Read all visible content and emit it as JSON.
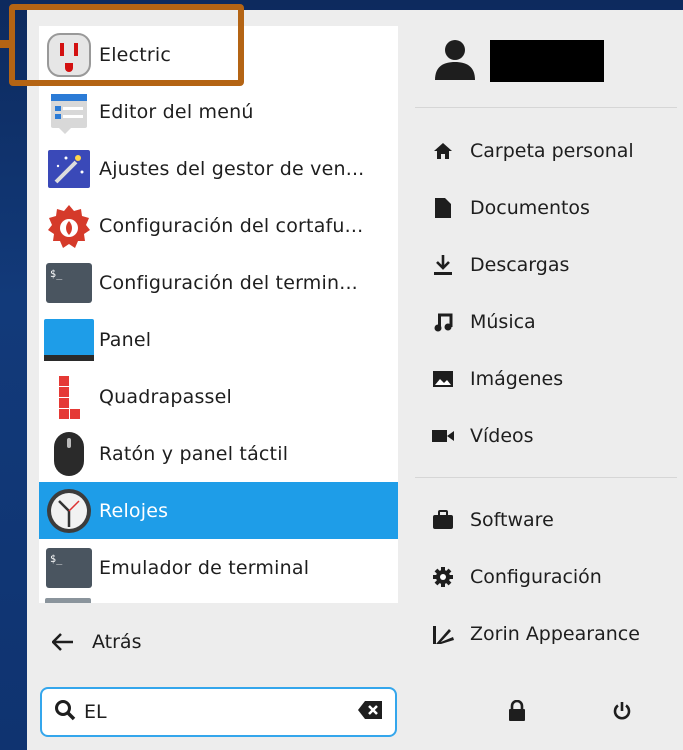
{
  "apps": [
    {
      "label": "Electric",
      "icon": "electric-outlet-icon"
    },
    {
      "label": "Editor del menú",
      "icon": "menu-editor-icon"
    },
    {
      "label": "Ajustes del gestor de ven...",
      "icon": "window-manager-tweaks-icon"
    },
    {
      "label": "Configuración del cortafu...",
      "icon": "firewall-icon"
    },
    {
      "label": "Configuración del termin...",
      "icon": "terminal-icon"
    },
    {
      "label": "Panel",
      "icon": "panel-icon"
    },
    {
      "label": "Quadrapassel",
      "icon": "quadrapassel-icon"
    },
    {
      "label": "Ratón y panel táctil",
      "icon": "mouse-icon"
    },
    {
      "label": "Relojes",
      "icon": "clock-icon"
    },
    {
      "label": "Emulador de terminal",
      "icon": "terminal-icon"
    }
  ],
  "back_label": "Atrás",
  "search": {
    "value": "EL"
  },
  "places": [
    {
      "label": "Carpeta personal",
      "icon": "home-icon"
    },
    {
      "label": "Documentos",
      "icon": "document-icon"
    },
    {
      "label": "Descargas",
      "icon": "download-icon"
    },
    {
      "label": "Música",
      "icon": "music-icon"
    },
    {
      "label": "Imágenes",
      "icon": "image-icon"
    },
    {
      "label": "Vídeos",
      "icon": "video-icon"
    }
  ],
  "system": [
    {
      "label": "Software",
      "icon": "software-bag-icon"
    },
    {
      "label": "Configuración",
      "icon": "gear-icon"
    },
    {
      "label": "Zorin Appearance",
      "icon": "zorin-appearance-icon"
    }
  ],
  "colors": {
    "selected": "#1e9de8",
    "highlight": "#b46414",
    "search_border": "#34a6ec"
  }
}
